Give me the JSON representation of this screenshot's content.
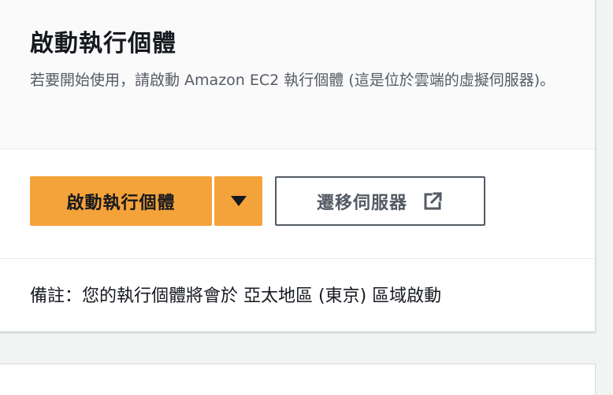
{
  "card": {
    "title": "啟動執行個體",
    "description": "若要開始使用，請啟動 Amazon EC2 執行個體 (這是位於雲端的虛擬伺服器)。"
  },
  "actions": {
    "launch_label": "啟動執行個體",
    "dropdown_icon": "caret-down-icon",
    "migrate_label": "遷移伺服器",
    "migrate_icon": "external-link-icon"
  },
  "footer": {
    "note": "備註：您的執行個體將會於 亞太地區 (東京) 區域啟動"
  },
  "colors": {
    "primary_button": "#f4a23a",
    "secondary_border": "#545b64",
    "text": "#16191f",
    "muted_text": "#545b64"
  }
}
